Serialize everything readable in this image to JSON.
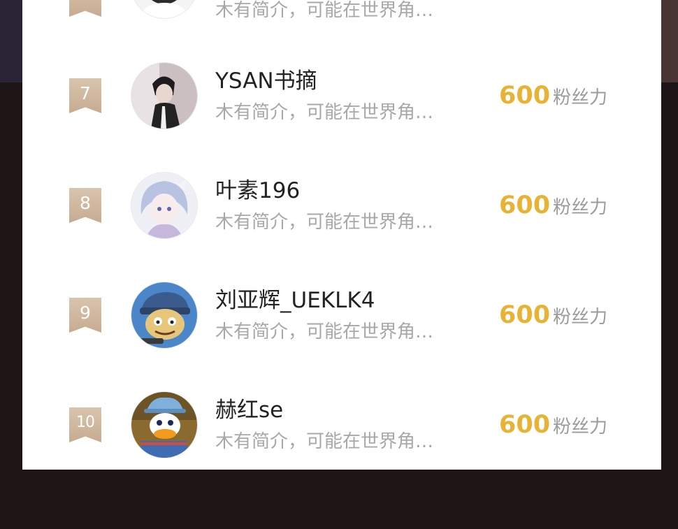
{
  "leaderboard": {
    "top_row": {
      "desc": "木有简介，可能在世界角…"
    },
    "rows": [
      {
        "rank": "7",
        "name": "YSAN书摘",
        "desc": "木有简介，可能在世界角…",
        "score": "600",
        "unit": "粉丝力"
      },
      {
        "rank": "8",
        "name": "叶素196",
        "desc": "木有简介，可能在世界角…",
        "score": "600",
        "unit": "粉丝力"
      },
      {
        "rank": "9",
        "name": "刘亚辉_UEKLK4",
        "desc": "木有简介，可能在世界角…",
        "score": "600",
        "unit": "粉丝力"
      },
      {
        "rank": "10",
        "name": "赫红se",
        "desc": "木有简介，可能在世界角…",
        "score": "600",
        "unit": "粉丝力"
      }
    ]
  },
  "colors": {
    "score": "#e8b234",
    "rank_badge": "#c9ae93",
    "panel": "#ffffff",
    "backdrop": "#1d1415"
  }
}
